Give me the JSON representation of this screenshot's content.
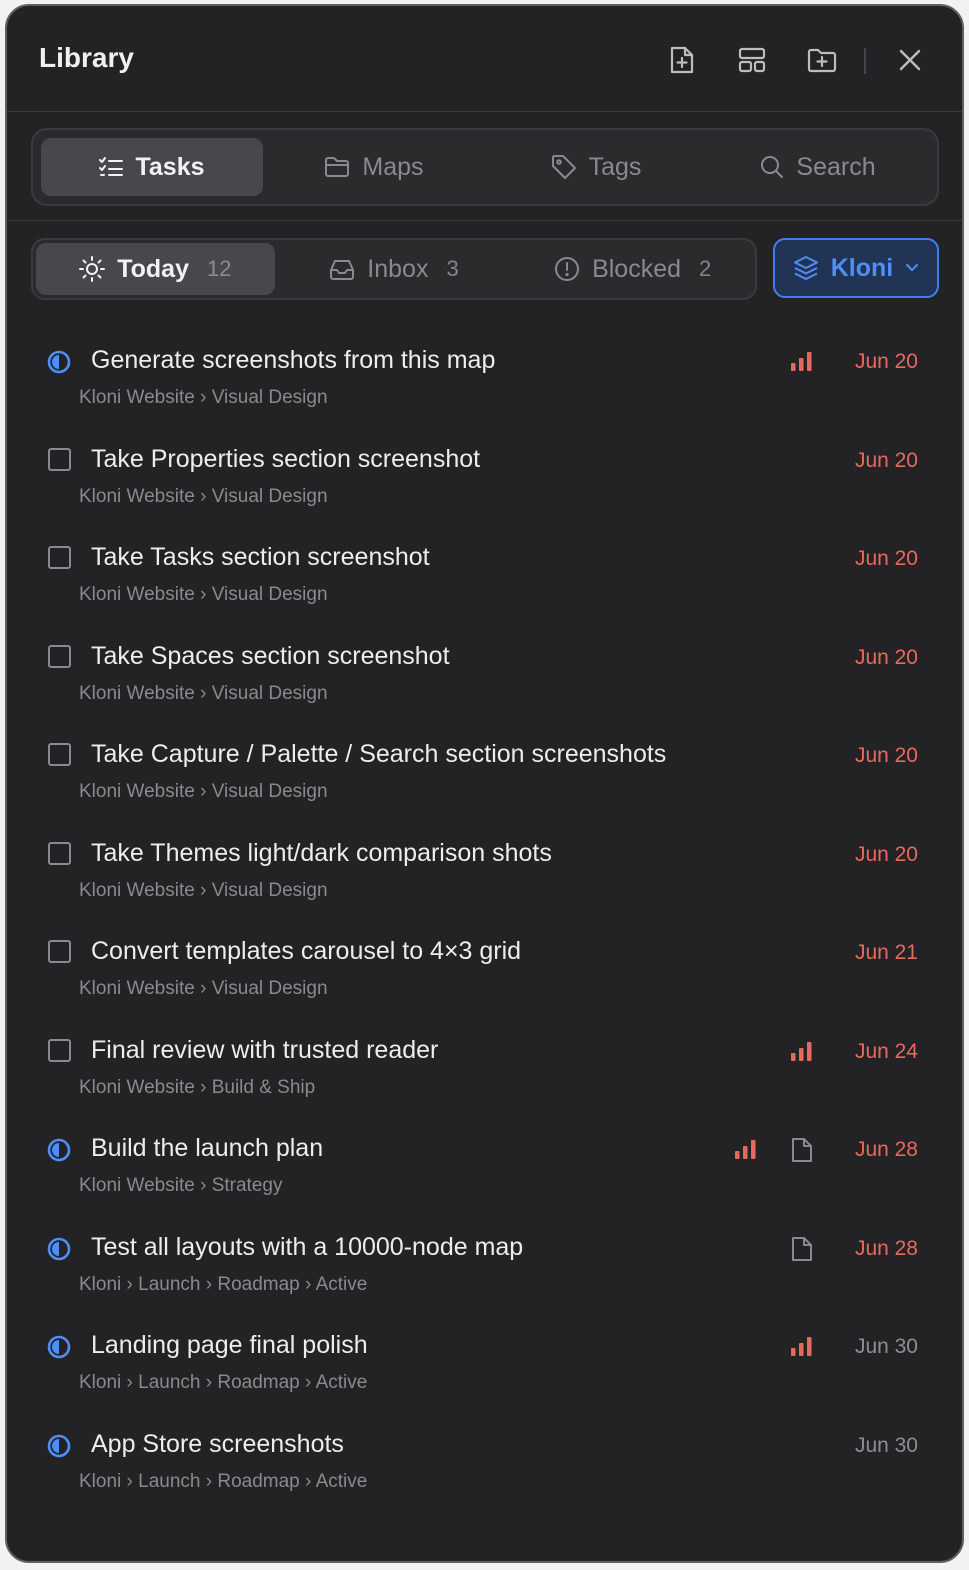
{
  "header": {
    "title": "Library",
    "icons": [
      "new-file-icon",
      "layout-icon",
      "new-folder-icon",
      "close-icon"
    ]
  },
  "tabs": [
    {
      "label": "Tasks",
      "icon": "checklist-icon",
      "active": true
    },
    {
      "label": "Maps",
      "icon": "folder-icon",
      "active": false
    },
    {
      "label": "Tags",
      "icon": "tag-icon",
      "active": false
    },
    {
      "label": "Search",
      "icon": "search-icon",
      "active": false
    }
  ],
  "filters": [
    {
      "label": "Today",
      "count": "12",
      "icon": "sun-icon",
      "active": true
    },
    {
      "label": "Inbox",
      "count": "3",
      "icon": "inbox-icon",
      "active": false
    },
    {
      "label": "Blocked",
      "count": "2",
      "icon": "alert-circle-icon",
      "active": false
    }
  ],
  "space": {
    "label": "Kloni",
    "icon": "layers-icon"
  },
  "colors": {
    "accent": "#4e8ff7",
    "overdue": "#e8685d",
    "muted": "#8e8e92",
    "background": "#232325"
  },
  "tasks": [
    {
      "title": "Generate screenshots from this map",
      "path": "Kloni Website › Visual Design",
      "due": "Jun 20",
      "status": "in-progress",
      "priority": true,
      "note": false
    },
    {
      "title": "Take Properties section screenshot",
      "path": "Kloni Website › Visual Design",
      "due": "Jun 20",
      "status": "todo",
      "priority": false,
      "note": false
    },
    {
      "title": "Take Tasks section screenshot",
      "path": "Kloni Website › Visual Design",
      "due": "Jun 20",
      "status": "todo",
      "priority": false,
      "note": false
    },
    {
      "title": "Take Spaces section screenshot",
      "path": "Kloni Website › Visual Design",
      "due": "Jun 20",
      "status": "todo",
      "priority": false,
      "note": false
    },
    {
      "title": "Take Capture / Palette / Search section screenshots",
      "path": "Kloni Website › Visual Design",
      "due": "Jun 20",
      "status": "todo",
      "priority": false,
      "note": false
    },
    {
      "title": "Take Themes light/dark comparison shots",
      "path": "Kloni Website › Visual Design",
      "due": "Jun 20",
      "status": "todo",
      "priority": false,
      "note": false
    },
    {
      "title": "Convert templates carousel to 4×3 grid",
      "path": "Kloni Website › Visual Design",
      "due": "Jun 21",
      "status": "todo",
      "priority": false,
      "note": false
    },
    {
      "title": "Final review with trusted reader",
      "path": "Kloni Website › Build & Ship",
      "due": "Jun 24",
      "status": "todo",
      "priority": true,
      "note": false
    },
    {
      "title": "Build the launch plan",
      "path": "Kloni Website › Strategy",
      "due": "Jun 28",
      "status": "in-progress",
      "priority": true,
      "note": true
    },
    {
      "title": "Test all layouts with a 10000-node map",
      "path": "Kloni › Launch › Roadmap › Active",
      "due": "Jun 28",
      "status": "in-progress",
      "priority": false,
      "note": true
    },
    {
      "title": "Landing page final polish",
      "path": "Kloni › Launch › Roadmap › Active",
      "due": "Jun 30",
      "status": "in-progress",
      "priority": true,
      "note": false,
      "due_muted": true
    },
    {
      "title": "App Store screenshots",
      "path": "Kloni › Launch › Roadmap › Active",
      "due": "Jun 30",
      "status": "in-progress",
      "priority": false,
      "note": false,
      "due_muted": true
    }
  ]
}
